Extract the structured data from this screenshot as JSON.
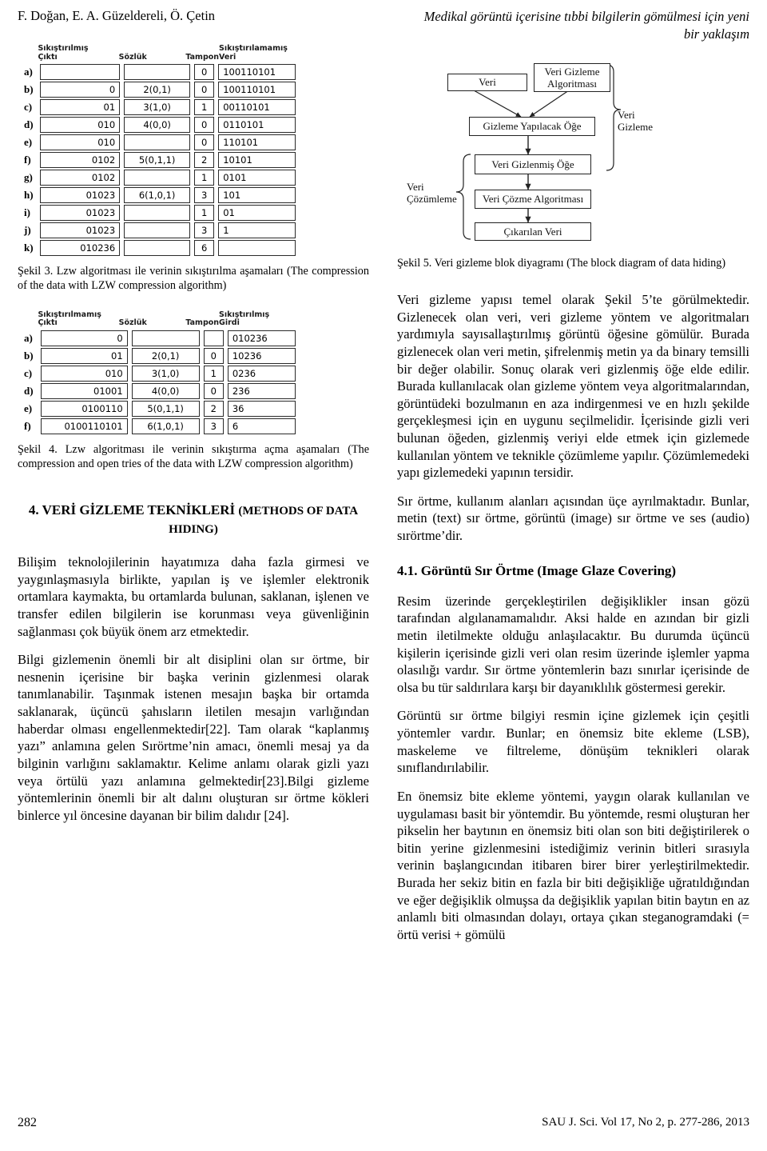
{
  "runhead": {
    "authors": "F. Doğan, E. A. Güzeldereli, Ö. Çetin",
    "title_line1": "Medikal görüntü içerisine tıbbi bilgilerin gömülmesi için yeni",
    "title_line2": "bir yaklaşım"
  },
  "figure3": {
    "headers": {
      "idx": "",
      "col1_line1": "Sıkıştırılmış",
      "col1_line2": "Çıktı",
      "col2": "Sözlük",
      "col3": "Tampon",
      "col4_line1": "Sıkıştırılamamış",
      "col4_line2": "Veri"
    },
    "rows": [
      {
        "idx": "a)",
        "out": "",
        "dict": "",
        "buf": "0",
        "data": "100110101"
      },
      {
        "idx": "b)",
        "out": "0",
        "dict": "2(0,1)",
        "buf": "0",
        "data": "100110101"
      },
      {
        "idx": "c)",
        "out": "01",
        "dict": "3(1,0)",
        "buf": "1",
        "data": "00110101"
      },
      {
        "idx": "d)",
        "out": "010",
        "dict": "4(0,0)",
        "buf": "0",
        "data": "0110101"
      },
      {
        "idx": "e)",
        "out": "010",
        "dict": "",
        "buf": "0",
        "data": "110101"
      },
      {
        "idx": "f)",
        "out": "0102",
        "dict": "5(0,1,1)",
        "buf": "2",
        "data": "10101"
      },
      {
        "idx": "g)",
        "out": "0102",
        "dict": "",
        "buf": "1",
        "data": "0101"
      },
      {
        "idx": "h)",
        "out": "01023",
        "dict": "6(1,0,1)",
        "buf": "3",
        "data": "101"
      },
      {
        "idx": "i)",
        "out": "01023",
        "dict": "",
        "buf": "1",
        "data": "01"
      },
      {
        "idx": "j)",
        "out": "01023",
        "dict": "",
        "buf": "3",
        "data": "1"
      },
      {
        "idx": "k)",
        "out": "010236",
        "dict": "",
        "buf": "6",
        "data": ""
      }
    ],
    "caption_tr": "Şekil 3. Lzw algoritması ile verinin sıkıştırılma aşamaları (The",
    "caption_en": "compression of the data with LZW compression algorithm)"
  },
  "figure4": {
    "headers": {
      "col1_line1": "Sıkıştırılmamış",
      "col1_line2": "Çıktı",
      "col2": "Sözlük",
      "col3": "Tampon",
      "col4_line1": "Sıkıştırılmış",
      "col4_line2": "Girdi"
    },
    "rows": [
      {
        "idx": "a)",
        "out": "0",
        "dict": "",
        "buf": "",
        "data": "010236"
      },
      {
        "idx": "b)",
        "out": "01",
        "dict": "2(0,1)",
        "buf": "0",
        "data": "10236"
      },
      {
        "idx": "c)",
        "out": "010",
        "dict": "3(1,0)",
        "buf": "1",
        "data": "0236"
      },
      {
        "idx": "d)",
        "out": "01001",
        "dict": "4(0,0)",
        "buf": "0",
        "data": "236"
      },
      {
        "idx": "e)",
        "out": "0100110",
        "dict": "5(0,1,1)",
        "buf": "2",
        "data": "36"
      },
      {
        "idx": "f)",
        "out": "0100110101",
        "dict": "6(1,0,1)",
        "buf": "3",
        "data": "6"
      }
    ],
    "caption_l1": "Şekil 4. Lzw algoritması ile verinin sıkıştırma açma aşamaları (The",
    "caption_l2": "compression and open tries of the data with LZW compression",
    "caption_l3": "algorithm)"
  },
  "figure5": {
    "boxes": {
      "veri": "Veri",
      "algoritma_l1": "Veri Gizleme",
      "algoritma_l2": "Algoritması",
      "gizleme_yapilacak": "Gizleme Yapılacak Öğe",
      "veri_gizlenmis": "Veri Gizlenmiş Öğe",
      "cozme_algoritmasi": "Veri Çözme Algoritması",
      "cikarilan_veri": "Çıkarılan Veri"
    },
    "brace_labels": {
      "gizleme_l1": "Veri",
      "gizleme_l2": "Gizleme",
      "cozumleme_l1": "Veri",
      "cozumleme_l2": "Çözümleme"
    },
    "caption_l1": "Şekil 5. Veri gizleme blok diyagramı (The block diagram of data",
    "caption_l2": "hiding)"
  },
  "left_column": {
    "section_title_tr": "4. VERİ GİZLEME TEKNİKLERİ ",
    "section_title_en": "(METHODS OF DATA HIDING)",
    "para1": "Bilişim teknolojilerinin hayatımıza daha fazla girmesi ve yaygınlaşmasıyla birlikte, yapılan iş ve işlemler elektronik ortamlara kaymakta, bu ortamlarda bulunan, saklanan, işlenen ve transfer edilen bilgilerin ise korunması veya güvenliğinin sağlanması çok büyük önem arz etmektedir.",
    "para2": "Bilgi gizlemenin önemli bir alt disiplini olan sır örtme, bir nesnenin içerisine bir başka verinin gizlenmesi olarak tanımlanabilir. Taşınmak istenen mesajın başka bir ortamda saklanarak, üçüncü şahısların iletilen mesajın varlığından haberdar olması engellenmektedir[22]. Tam olarak “kaplanmış yazı” anlamına gelen Sırörtme’nin amacı, önemli mesaj ya da bilginin varlığını saklamaktır. Kelime anlamı olarak gizli yazı veya örtülü yazı anlamına gelmektedir[23].Bilgi gizleme yöntemlerinin önemli bir alt dalını oluşturan sır örtme kökleri binlerce yıl öncesine dayanan bir bilim dalıdır [24]."
  },
  "right_column": {
    "para1": "Veri gizleme yapısı temel olarak Şekil 5’te görülmektedir. Gizlenecek olan veri, veri gizleme yöntem ve algoritmaları yardımıyla sayısallaştırılmış görüntü öğesine gömülür. Burada gizlenecek olan veri metin, şifrelenmiş metin ya da binary temsilli bir değer olabilir. Sonuç olarak veri gizlenmiş öğe elde edilir. Burada kullanılacak olan gizleme yöntem veya algoritmalarından, görüntüdeki bozulmanın en aza indirgenmesi ve en hızlı şekilde gerçekleşmesi için en uygunu seçilmelidir.  İçerisinde gizli veri bulunan öğeden, gizlenmiş veriyi elde etmek için gizlemede kullanılan yöntem ve teknikle çözümleme yapılır. Çözümlemedeki yapı gizlemedeki yapının tersidir.",
    "para2": "Sır örtme, kullanım alanları açısından üçe ayrılmaktadır. Bunlar, metin (text) sır örtme, görüntü (image) sır örtme ve ses (audio) sırörtme’dir.",
    "subsection_title": "4.1. Görüntü Sır Örtme (Image Glaze Covering)",
    "para3": "Resim üzerinde gerçekleştirilen değişiklikler insan gözü tarafından algılanamamalıdır. Aksi halde en azından bir gizli metin iletilmekte olduğu anlaşılacaktır. Bu durumda üçüncü kişilerin içerisinde gizli veri olan resim üzerinde işlemler yapma olasılığı vardır. Sır örtme yöntemlerin bazı sınırlar içerisinde de olsa bu tür saldırılara karşı bir dayanıklılık göstermesi gerekir.",
    "para4": "Görüntü sır örtme bilgiyi resmin içine gizlemek için çeşitli yöntemler vardır. Bunlar; en önemsiz bite ekleme (LSB), maskeleme ve filtreleme, dönüşüm teknikleri olarak sınıflandırılabilir.",
    "para5": "En önemsiz bite ekleme yöntemi, yaygın olarak kullanılan ve uygulaması basit bir yöntemdir. Bu yöntemde, resmi oluşturan her pikselin her baytının en önemsiz biti olan son biti değiştirilerek o bitin yerine gizlenmesini istediğimiz verinin bitleri sırasıyla verinin başlangıcından itibaren birer birer yerleştirilmektedir. Burada her sekiz bitin en fazla bir biti değişikliğe uğratıldığından ve eğer değişiklik olmuşsa da değişiklik yapılan bitin baytın en az anlamlı biti olmasından dolayı, ortaya çıkan steganogramdaki (= örtü verisi + gömülü"
  },
  "footer": {
    "page_number": "282",
    "journal_ref": "SAU J. Sci. Vol 17, No 2, p. 277-286, 2013"
  }
}
